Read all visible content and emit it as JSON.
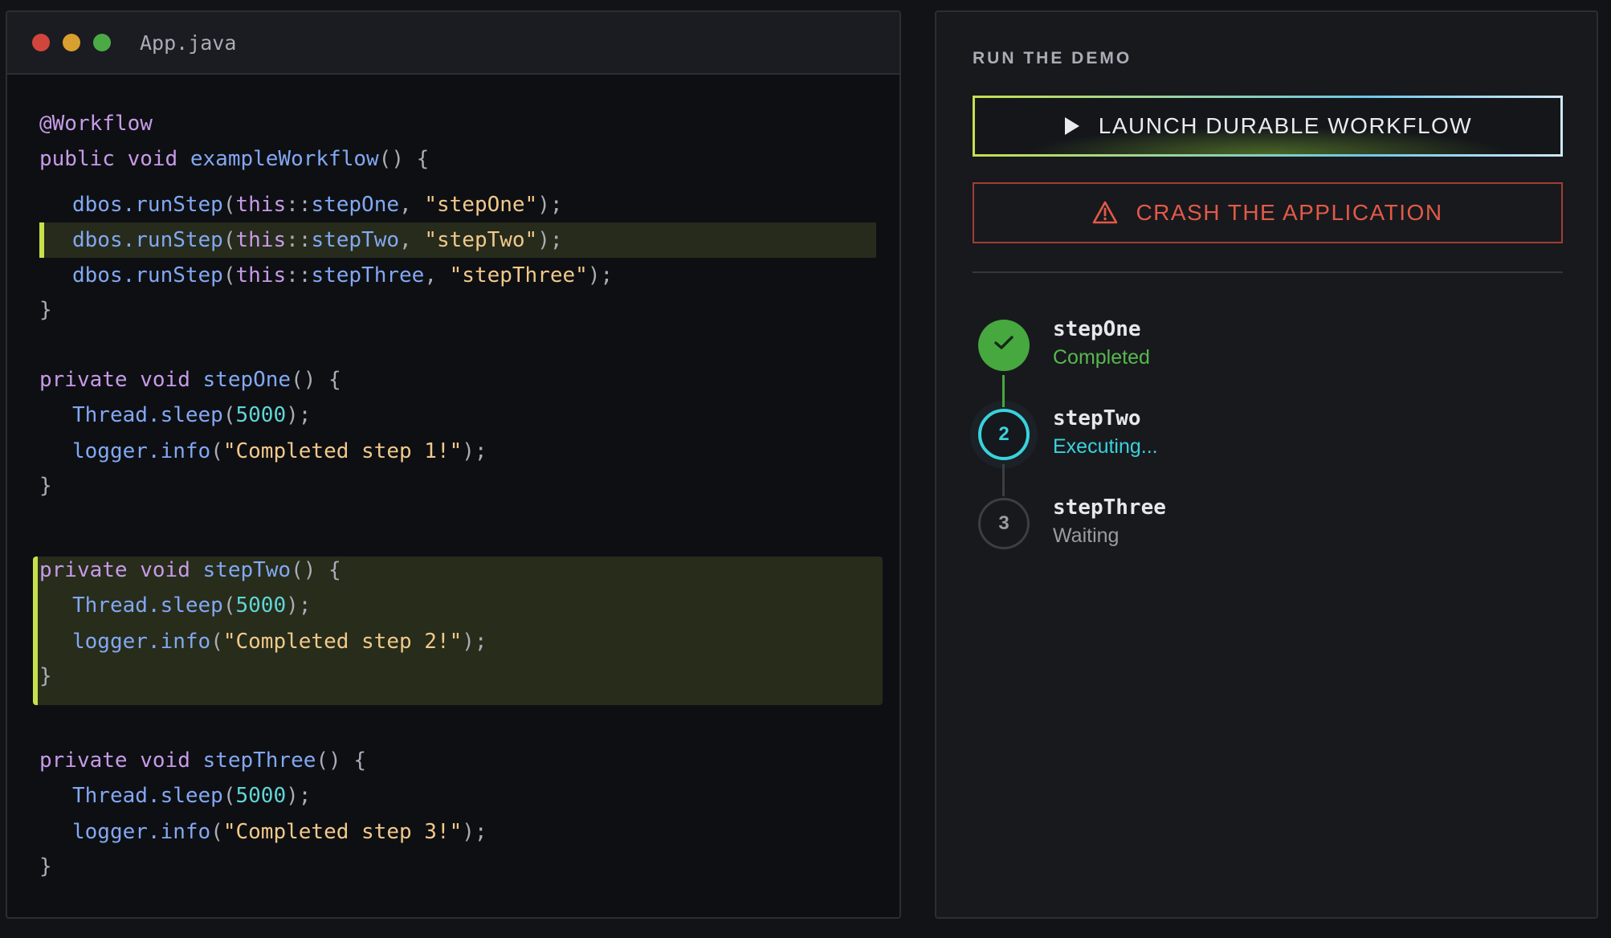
{
  "editor": {
    "filename": "App.java",
    "lines": {
      "l1": {
        "annot": "@Workflow"
      },
      "l2": {
        "mod": "public",
        "type": "void",
        "name": "exampleWorkflow",
        "open": "() {"
      },
      "l3": {
        "obj": "dbos.runStep",
        "p1": "(",
        "kw": "this",
        "sep": "::",
        "ref": "stepOne",
        "comma": ", ",
        "str": "\"stepOne\"",
        "end": ");"
      },
      "l4": {
        "obj": "dbos.runStep",
        "p1": "(",
        "kw": "this",
        "sep": "::",
        "ref": "stepTwo",
        "comma": ", ",
        "str": "\"stepTwo\"",
        "end": ");"
      },
      "l5": {
        "obj": "dbos.runStep",
        "p1": "(",
        "kw": "this",
        "sep": "::",
        "ref": "stepThree",
        "comma": ", ",
        "str": "\"stepThree\"",
        "end": ");"
      },
      "l6": {
        "close": "}"
      },
      "l7": {
        "mod": "private",
        "type": "void",
        "name": "stepOne",
        "open": "() {"
      },
      "l8": {
        "obj": "Thread.sleep",
        "p1": "(",
        "num": "5000",
        "end": ");"
      },
      "l9": {
        "obj": "logger.info",
        "p1": "(",
        "str": "\"Completed step 1!\"",
        "end": ");"
      },
      "l10": {
        "close": "}"
      },
      "l11": {
        "mod": "private",
        "type": "void",
        "name": "stepTwo",
        "open": "() {"
      },
      "l12": {
        "obj": "Thread.sleep",
        "p1": "(",
        "num": "5000",
        "end": ");"
      },
      "l13": {
        "obj": "logger.info",
        "p1": "(",
        "str": "\"Completed step 2!\"",
        "end": ");"
      },
      "l14": {
        "close": "}"
      },
      "l15": {
        "mod": "private",
        "type": "void",
        "name": "stepThree",
        "open": "() {"
      },
      "l16": {
        "obj": "Thread.sleep",
        "p1": "(",
        "num": "5000",
        "end": ");"
      },
      "l17": {
        "obj": "logger.info",
        "p1": "(",
        "str": "\"Completed step 3!\"",
        "end": ");"
      },
      "l18": {
        "close": "}"
      }
    }
  },
  "panel": {
    "title": "RUN THE DEMO",
    "launch_label": "LAUNCH DURABLE WORKFLOW",
    "crash_label": "CRASH THE APPLICATION",
    "steps": [
      {
        "name": "stepOne",
        "status": "Completed",
        "state": "completed"
      },
      {
        "name": "stepTwo",
        "status": "Executing...",
        "state": "executing",
        "number": "2"
      },
      {
        "name": "stepThree",
        "status": "Waiting",
        "state": "waiting",
        "number": "3"
      }
    ]
  },
  "colors": {
    "accent_lime": "#c8e04a",
    "completed_green": "#46a83e",
    "executing_cyan": "#38d3dd",
    "danger_red": "#e25a48"
  },
  "icons": {
    "launch": "play-icon",
    "crash": "warning-triangle-icon",
    "completed_step": "checkmark-icon"
  }
}
